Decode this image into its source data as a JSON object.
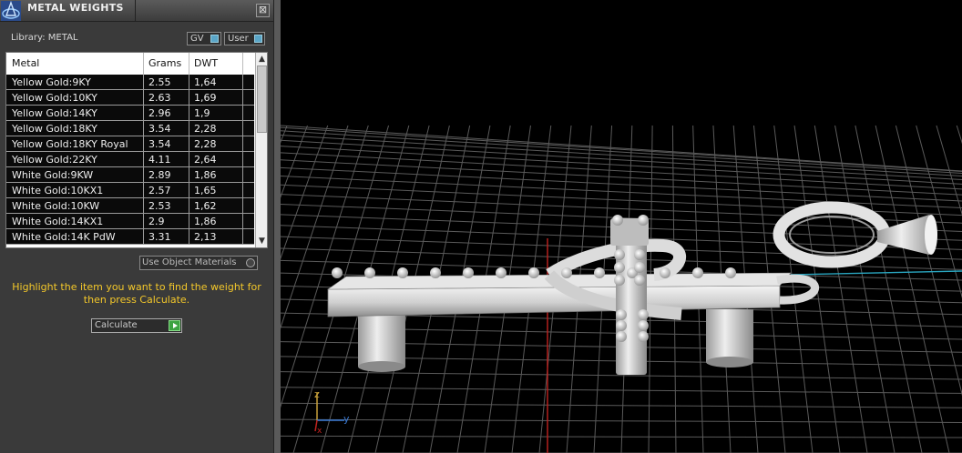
{
  "panel": {
    "title": "METAL WEIGHTS",
    "close_glyph": "⊠",
    "library_label": "Library: METAL",
    "toggle_gv": "GV",
    "toggle_user": "User",
    "columns": [
      "Metal",
      "Grams",
      "DWT"
    ],
    "rows": [
      [
        "Yellow Gold:9KY",
        "2.55",
        "1,64"
      ],
      [
        "Yellow Gold:10KY",
        "2.63",
        "1,69"
      ],
      [
        "Yellow Gold:14KY",
        "2.96",
        "1,9"
      ],
      [
        "Yellow Gold:18KY",
        "3.54",
        "2,28"
      ],
      [
        "Yellow Gold:18KY Royal",
        "3.54",
        "2,28"
      ],
      [
        "Yellow Gold:22KY",
        "4.11",
        "2,64"
      ],
      [
        "White Gold:9KW",
        "2.89",
        "1,86"
      ],
      [
        "White Gold:10KX1",
        "2.57",
        "1,65"
      ],
      [
        "White Gold:10KW",
        "2.53",
        "1,62"
      ],
      [
        "White Gold:14KX1",
        "2.9",
        "1,86"
      ],
      [
        "White Gold:14K PdW",
        "3.31",
        "2,13"
      ]
    ],
    "use_object_materials": "Use Object Materials",
    "hint": "Highlight the item you want to find the weight for then press Calculate.",
    "calculate_label": "Calculate"
  },
  "viewport": {
    "axis_z": "z",
    "axis_y": "y",
    "axis_x": "x"
  },
  "colors": {
    "hint": "#f4c82a",
    "accent_toggle": "#5aa6c8",
    "go_button": "#3da341"
  }
}
